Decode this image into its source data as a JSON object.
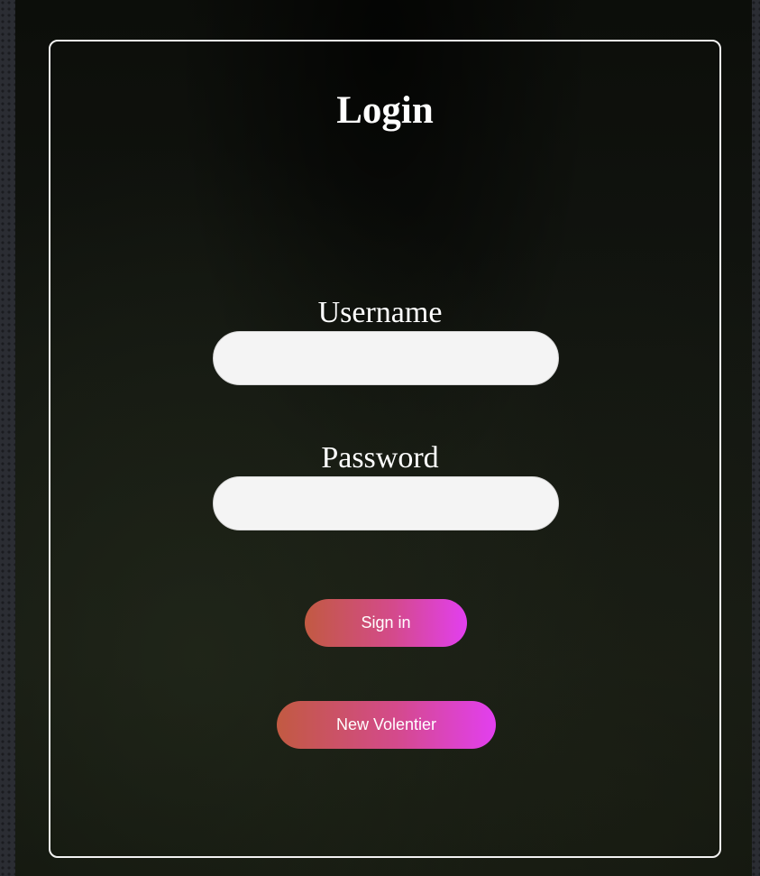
{
  "login": {
    "title": "Login",
    "username": {
      "label": "Username",
      "value": "",
      "placeholder": ""
    },
    "password": {
      "label": "Password",
      "value": "",
      "placeholder": ""
    },
    "sign_in_label": "Sign in",
    "new_volunteer_label": "New Volentier"
  },
  "colors": {
    "card_border": "#f2f2f2",
    "input_background": "#f4f4f4",
    "button_gradient_start": "#c25a42",
    "button_gradient_end": "#e23ff0",
    "text": "#ffffff"
  }
}
